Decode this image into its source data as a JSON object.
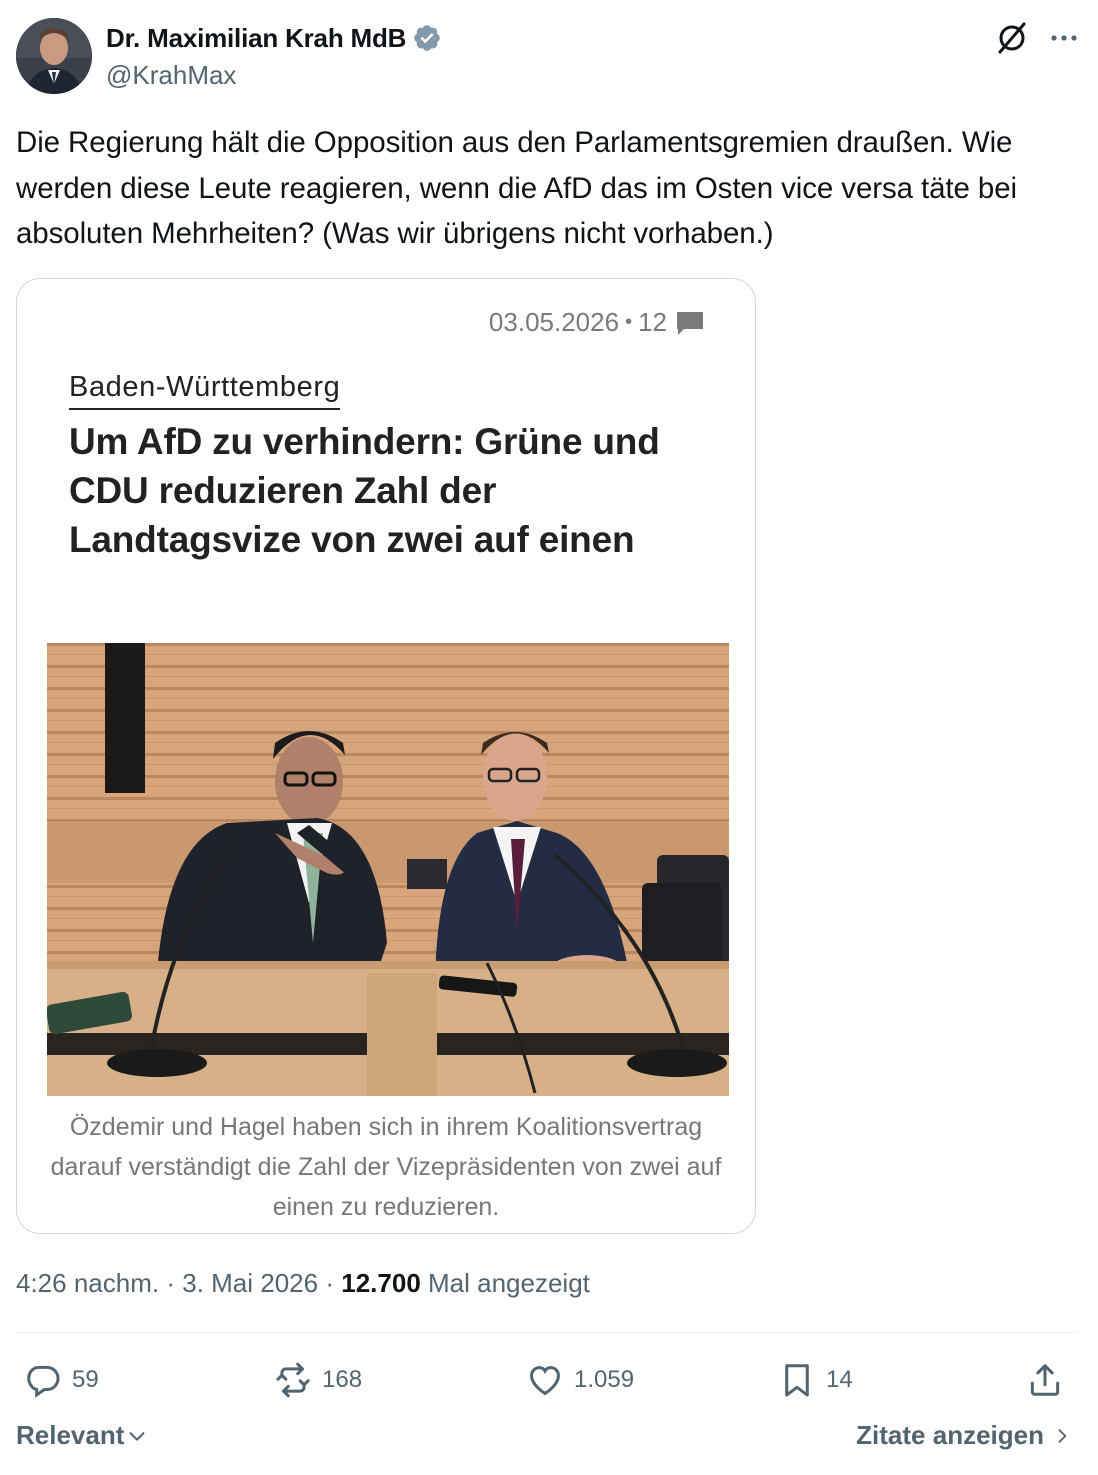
{
  "author": {
    "name": "Dr. Maximilian Krah MdB",
    "handle": "@KrahMax"
  },
  "tweet": {
    "text": "Die Regierung hält die Opposition aus den Parlamentsgremien draußen. Wie werden diese Leute reagieren, wenn die AfD das im Osten vice versa täte bei absoluten Mehrheiten? (Was wir übrigens nicht vorhaben.)"
  },
  "card": {
    "date": "03.05.2026",
    "separator": "•",
    "comment_count": "12",
    "kicker": "Baden-Württemberg",
    "headline": "Um AfD zu verhindern: Grüne und CDU reduzieren Zahl der Landtagsvize von zwei auf einen",
    "caption": "Özdemir und Hagel haben sich in ihrem Koalitionsvertrag darauf verständigt die Zahl der Vizepräsidenten von zwei auf einen zu reduzieren."
  },
  "meta": {
    "time": "4:26 nachm.",
    "sep1": "·",
    "date": "3. Mai 2026",
    "sep2": "·",
    "views": "12.700",
    "views_label": "Mal angezeigt"
  },
  "actions": {
    "replies": "59",
    "reposts": "168",
    "likes": "1.059",
    "bookmarks": "14"
  },
  "footer": {
    "sort_label": "Relevant",
    "quotes_label": "Zitate anzeigen"
  },
  "colors": {
    "text": "#0f1419",
    "secondary": "#536471",
    "verified": "#829aab",
    "border": "#cfd9de"
  }
}
